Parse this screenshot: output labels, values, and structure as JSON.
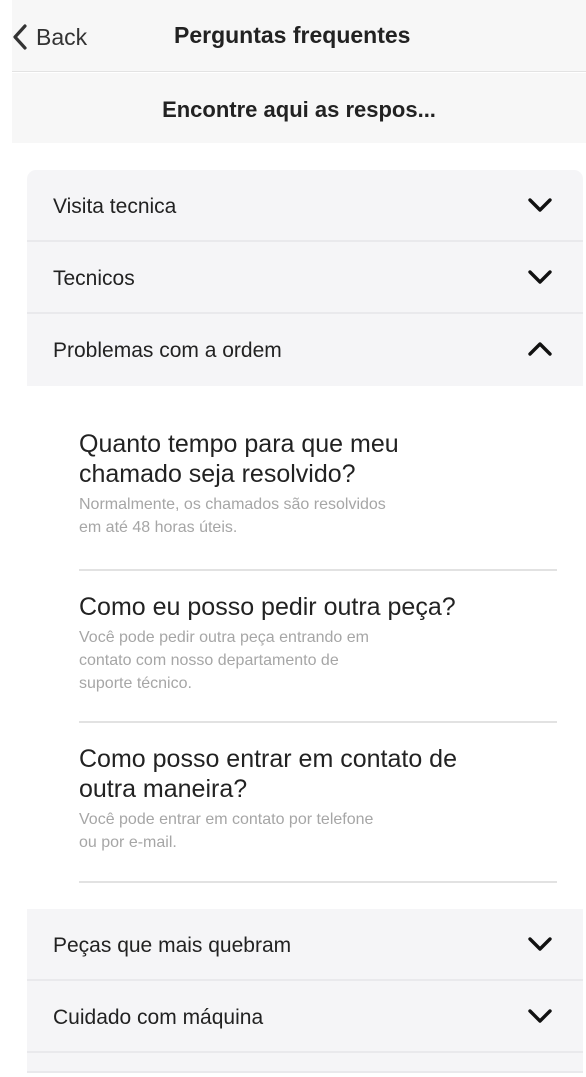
{
  "header": {
    "back_label": "Back",
    "title": "Perguntas frequentes"
  },
  "search": {
    "label": "Encontre aqui as respos..."
  },
  "sections": [
    {
      "label": "Visita tecnica",
      "state": "collapsed",
      "icon": "chevron-down-icon"
    },
    {
      "label": "Tecnicos",
      "state": "collapsed",
      "icon": "chevron-down-icon"
    },
    {
      "label": "Problemas com a ordem",
      "state": "expanded",
      "icon": "chevron-up-icon"
    },
    {
      "label": "Peças que mais quebram",
      "state": "collapsed",
      "icon": "chevron-down-icon"
    },
    {
      "label": "Cuidado com máquina",
      "state": "collapsed",
      "icon": "chevron-down-icon"
    }
  ],
  "expanded_items": [
    {
      "question_lines": [
        "Quanto tempo para que meu",
        "chamado seja resolvido?"
      ],
      "answer_lines": [
        "Normalmente, os chamados são resolvidos",
        "em até 48 horas úteis."
      ]
    },
    {
      "question_lines": [
        "Como eu posso pedir outra peça?"
      ],
      "answer_lines": [
        "Você pode pedir outra peça entrando em",
        "contato com nosso departamento de",
        "suporte técnico."
      ]
    },
    {
      "question_lines": [
        "Como posso entrar em contato de",
        "outra maneira?"
      ],
      "answer_lines": [
        "Você pode entrar em contato por telefone",
        "ou por e-mail."
      ]
    }
  ],
  "colors": {
    "header_bg": "#f7f7f7",
    "row_bg": "#f5f5f7",
    "answer_text": "#a6a6a6"
  }
}
